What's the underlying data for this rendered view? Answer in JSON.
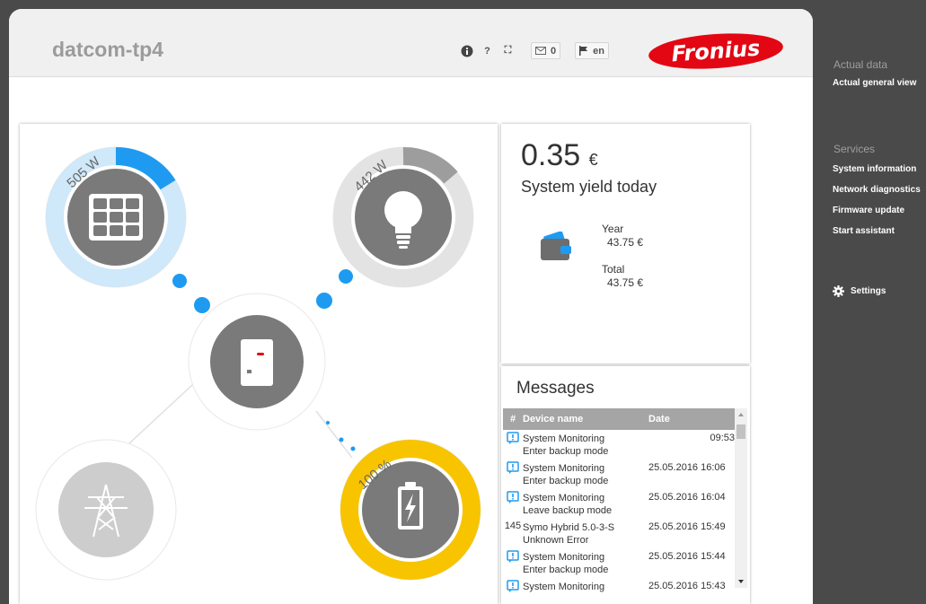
{
  "header": {
    "title": "datcom-tp4",
    "tools": {
      "info_label": "i",
      "help_label": "?",
      "fullscreen_label": "⛶",
      "messages_count": "0",
      "language": "en"
    },
    "logo_text": "Fronius"
  },
  "flow": {
    "pv_power": "505 W",
    "load_power": "442 W",
    "battery_soc": "100 %"
  },
  "yield": {
    "value": "0.35",
    "currency": "€",
    "label": "System yield today",
    "year_label": "Year",
    "year_value": "43.75 €",
    "total_label": "Total",
    "total_value": "43.75 €"
  },
  "messages": {
    "title": "Messages",
    "columns": [
      "#",
      "Device name",
      "Date"
    ],
    "rows": [
      {
        "num": "",
        "device": "System Monitoring",
        "detail": "Enter backup mode",
        "date": "09:53",
        "icon": true
      },
      {
        "num": "",
        "device": "System Monitoring",
        "detail": "Enter backup mode",
        "date": "25.05.2016 16:06",
        "icon": true
      },
      {
        "num": "",
        "device": "System Monitoring",
        "detail": "Leave backup mode",
        "date": "25.05.2016 16:04",
        "icon": true
      },
      {
        "num": "145",
        "device": "Symo Hybrid 5.0-3-S",
        "detail": "Unknown Error",
        "date": "25.05.2016 15:49",
        "icon": false
      },
      {
        "num": "",
        "device": "System Monitoring",
        "detail": "Enter backup mode",
        "date": "25.05.2016 15:44",
        "icon": true
      },
      {
        "num": "",
        "device": "System Monitoring",
        "detail": "",
        "date": "25.05.2016 15:43",
        "icon": true
      }
    ]
  },
  "sidebar": {
    "actual_heading": "Actual data",
    "actual_general_view": "Actual general view",
    "services_heading": "Services",
    "system_information": "System information",
    "network_diagnostics": "Network diagnostics",
    "firmware_update": "Firmware update",
    "start_assistant": "Start assistant",
    "settings": "Settings"
  },
  "colors": {
    "pv": "#1e9bf0",
    "pv_light": "#cfe8fa",
    "battery": "#f8c400",
    "node": "#7a7a7a",
    "grid_node": "#cdcdcd",
    "brand": "#e30613"
  }
}
